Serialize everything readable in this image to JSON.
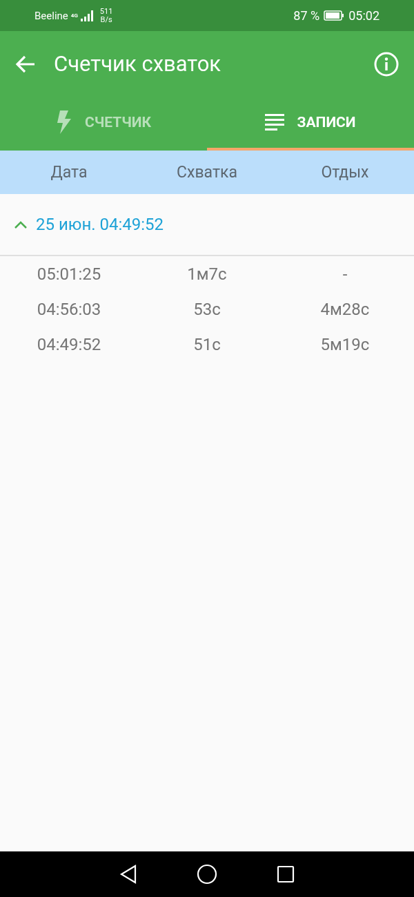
{
  "status_bar": {
    "carrier": "Beeline",
    "network": "4G",
    "speed_value": "511",
    "speed_unit": "B/s",
    "battery": "87 %",
    "time": "05:02"
  },
  "app_bar": {
    "title": "Счетчик схваток"
  },
  "tabs": [
    {
      "label": "СЧЕТЧИК",
      "kind": "bolt",
      "selected": false
    },
    {
      "label": "ЗАПИСИ",
      "kind": "list",
      "selected": true
    }
  ],
  "table": {
    "columns": [
      "Дата",
      "Схватка",
      "Отдых"
    ],
    "groups": [
      {
        "title": "25 июн. 04:49:52",
        "expanded": true,
        "rows": [
          [
            "05:01:25",
            "1м7с",
            "-"
          ],
          [
            "04:56:03",
            "53с",
            "4м28с"
          ],
          [
            "04:49:52",
            "51с",
            "5м19с"
          ]
        ]
      }
    ]
  }
}
